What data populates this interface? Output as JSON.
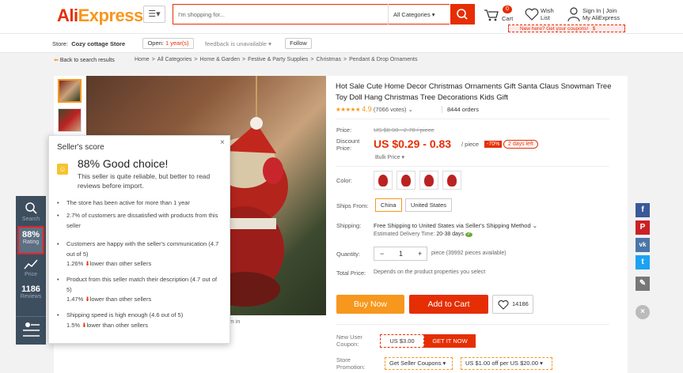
{
  "header": {
    "logo_part1": "Ali",
    "logo_part2": "Express",
    "search_placeholder": "I'm shopping for...",
    "all_categories": "All Categories",
    "cart_count": "0",
    "cart_label": "Cart",
    "wish_line1": "Wish",
    "wish_line2": "List",
    "signin": "Sign In",
    "join": "Join",
    "my_aliexpress": "My AliExpress",
    "new_here": "New here? Get your coupons!",
    "new_here_amount": "$"
  },
  "store": {
    "label": "Store:",
    "name": "Cozy cottage Store",
    "open_label": "Open:",
    "open_years": "1 year(s)",
    "feedback": "feedback is unavailable",
    "follow": "Follow"
  },
  "breadcrumb": {
    "back": "Back to search results",
    "items": [
      "Home",
      "All Categories",
      "Home & Garden",
      "Festive & Party Supplies",
      "Christmas",
      "Pendant & Drop Ornaments"
    ]
  },
  "product": {
    "title": "Hot Sale Cute Home Decor Christmas Ornaments Gift Santa Claus Snowman Tree Toy Doll Hang Christmas Tree Decorations Kids Gift",
    "stars": "★★★★★",
    "rating": "4.9",
    "votes": "(7066 votes)",
    "orders": "8444 orders",
    "price_label": "Price:",
    "old_price": "US $0.98 - 2.78 / piece",
    "discount_label_1": "Discount",
    "discount_label_2": "Price:",
    "price": "US $0.29 - 0.83",
    "per_piece": "/ piece",
    "discount_pct": "-70%",
    "days_left": "2 days left",
    "bulk": "Bulk Price ▾",
    "color_label": "Color:",
    "ships_from_label": "Ships From:",
    "ships_from_options": [
      "China",
      "United States"
    ],
    "shipping_label": "Shipping:",
    "shipping_text": "Free Shipping to United States via Seller's Shipping Method",
    "edt_label": "Estimated Delivery Time:",
    "edt_value": "20-38 days",
    "quantity_label": "Quantity:",
    "qty_minus": "−",
    "qty_value": "1",
    "qty_plus": "+",
    "pieces_available": "piece (39992 pieces available)",
    "total_label": "Total Price:",
    "total_text": "Depends on the product properties you select",
    "buy_now": "Buy Now",
    "add_to_cart": "Add to Cart",
    "wish_count": "14186",
    "new_user_coupon_1": "New User",
    "new_user_coupon_2": "Coupon:",
    "coupon_value": "US $3.00",
    "get_it_now": "GET IT NOW",
    "store_promo_1": "Store",
    "store_promo_2": "Promotion:",
    "get_seller_coupons": "Get Seller Coupons",
    "promo_value": "US $1.00 off per US $20.00"
  },
  "image_caption": "m in",
  "left_bar": {
    "search": "Search",
    "rating_value": "88%",
    "rating_label": "Rating",
    "price": "Price",
    "reviews_value": "1186",
    "reviews_label": "Reviews"
  },
  "popup": {
    "title": "Seller's score",
    "close": "×",
    "headline": "88% Good choice!",
    "description": "This seller is quite reliable, but better to read reviews before import.",
    "b1": "The store has been active for more than 1 year",
    "b2": "2.7% of customers are dissatisfied with products from this seller",
    "b3": "Customers are happy with the seller's communication (4.7 out of 5)",
    "b3_stat": "1.26%",
    "b4": "Product from this seller match their description (4.7 out of 5)",
    "b4_stat": "1.47%",
    "b5": "Shipping speed is high enough (4.6 out of 5)",
    "b5_stat": "1.5%",
    "lower_text": "lower than other sellers"
  },
  "social": [
    "f",
    "P",
    "vk",
    "t",
    "✎",
    "×"
  ],
  "colors": {
    "brand": "#e62e04",
    "orange": "#f7971d",
    "sidebar": "#3d4e5e"
  }
}
